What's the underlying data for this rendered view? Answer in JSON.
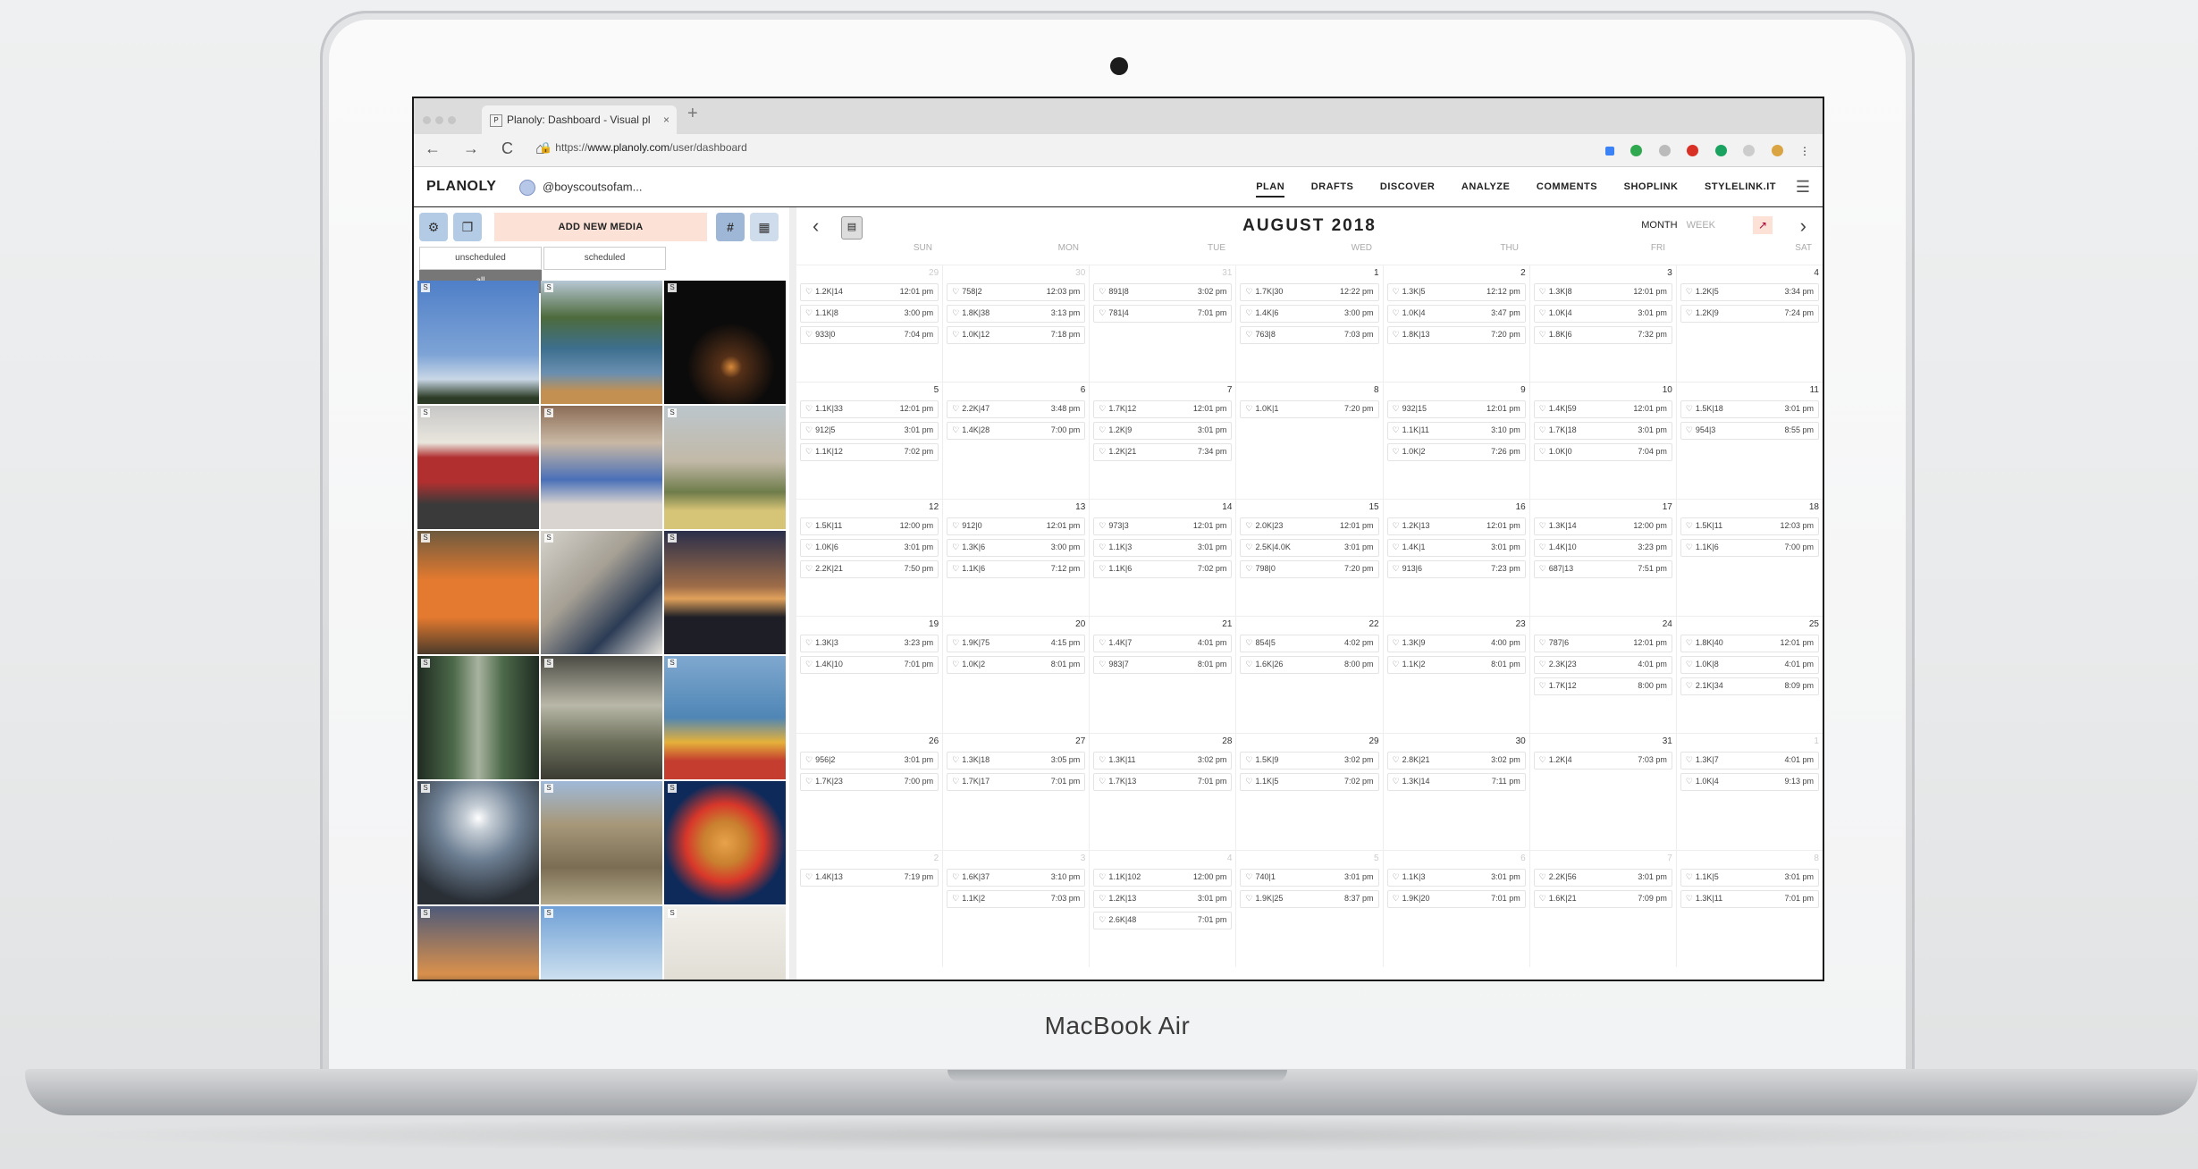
{
  "device": {
    "brand": "MacBook Air"
  },
  "browser": {
    "tab_title": "Planoly: Dashboard - Visual pl",
    "tab_close": "×",
    "new_tab": "+",
    "nav_icons": "← → C ⌂",
    "url_prefix": "https://",
    "url_host": "www.planoly.com",
    "url_path": "/user/dashboard"
  },
  "header": {
    "logo": "PLANOLY",
    "account": "@boyscoutsofam...",
    "menu": [
      "PLAN",
      "DRAFTS",
      "DISCOVER",
      "ANALYZE",
      "COMMENTS",
      "SHOPLINK",
      "STYLELINK.IT"
    ],
    "active": "PLAN"
  },
  "left_panel": {
    "add_media": "ADD NEW MEDIA",
    "hashtag": "#",
    "filters": [
      "unscheduled",
      "scheduled",
      "all"
    ],
    "active_filter": "all",
    "tile_badge": "S",
    "tiles": [
      "sky",
      "canoe-lake",
      "campfire",
      "license-plate",
      "booth",
      "group-outdoor",
      "orange-shirts",
      "computer",
      "sunset-lake",
      "forest-path",
      "sunbeam-forest",
      "kayaks",
      "moon-lake",
      "rocky-tower",
      "pancakes",
      "sunset-city",
      "sky-trees",
      "drawing"
    ]
  },
  "calendar": {
    "title": "AUGUST 2018",
    "view_month": "MONTH",
    "view_week": "WEEK",
    "days": [
      "SUN",
      "MON",
      "TUE",
      "WED",
      "THU",
      "FRI",
      "SAT"
    ],
    "weeks": [
      [
        {
          "d": "29",
          "o": true,
          "p": [
            [
              "1.2K|14",
              "12:01 pm"
            ],
            [
              "1.1K|8",
              "3:00 pm"
            ],
            [
              "933|0",
              "7:04 pm"
            ]
          ]
        },
        {
          "d": "30",
          "o": true,
          "p": [
            [
              "758|2",
              "12:03 pm"
            ],
            [
              "1.8K|38",
              "3:13 pm"
            ],
            [
              "1.0K|12",
              "7:18 pm"
            ]
          ]
        },
        {
          "d": "31",
          "o": true,
          "p": [
            [
              "891|8",
              "3:02 pm"
            ],
            [
              "781|4",
              "7:01 pm"
            ]
          ]
        },
        {
          "d": "1",
          "p": [
            [
              "1.7K|30",
              "12:22 pm"
            ],
            [
              "1.4K|6",
              "3:00 pm"
            ],
            [
              "763|8",
              "7:03 pm"
            ]
          ]
        },
        {
          "d": "2",
          "p": [
            [
              "1.3K|5",
              "12:12 pm"
            ],
            [
              "1.0K|4",
              "3:47 pm"
            ],
            [
              "1.8K|13",
              "7:20 pm"
            ]
          ]
        },
        {
          "d": "3",
          "p": [
            [
              "1.3K|8",
              "12:01 pm"
            ],
            [
              "1.0K|4",
              "3:01 pm"
            ],
            [
              "1.8K|6",
              "7:32 pm"
            ]
          ]
        },
        {
          "d": "4",
          "p": [
            [
              "1.2K|5",
              "3:34 pm"
            ],
            [
              "1.2K|9",
              "7:24 pm"
            ]
          ]
        }
      ],
      [
        {
          "d": "5",
          "p": [
            [
              "1.1K|33",
              "12:01 pm"
            ],
            [
              "912|5",
              "3:01 pm"
            ],
            [
              "1.1K|12",
              "7:02 pm"
            ]
          ]
        },
        {
          "d": "6",
          "p": [
            [
              "2.2K|47",
              "3:48 pm"
            ],
            [
              "1.4K|28",
              "7:00 pm"
            ]
          ]
        },
        {
          "d": "7",
          "p": [
            [
              "1.7K|12",
              "12:01 pm"
            ],
            [
              "1.2K|9",
              "3:01 pm"
            ],
            [
              "1.2K|21",
              "7:34 pm"
            ]
          ]
        },
        {
          "d": "8",
          "p": [
            [
              "1.0K|1",
              "7:20 pm"
            ]
          ]
        },
        {
          "d": "9",
          "p": [
            [
              "932|15",
              "12:01 pm"
            ],
            [
              "1.1K|11",
              "3:10 pm"
            ],
            [
              "1.0K|2",
              "7:26 pm"
            ]
          ]
        },
        {
          "d": "10",
          "p": [
            [
              "1.4K|59",
              "12:01 pm"
            ],
            [
              "1.7K|18",
              "3:01 pm"
            ],
            [
              "1.0K|0",
              "7:04 pm"
            ]
          ]
        },
        {
          "d": "11",
          "p": [
            [
              "1.5K|18",
              "3:01 pm"
            ],
            [
              "954|3",
              "8:55 pm"
            ]
          ]
        }
      ],
      [
        {
          "d": "12",
          "p": [
            [
              "1.5K|11",
              "12:00 pm"
            ],
            [
              "1.0K|6",
              "3:01 pm"
            ],
            [
              "2.2K|21",
              "7:50 pm"
            ]
          ]
        },
        {
          "d": "13",
          "p": [
            [
              "912|0",
              "12:01 pm"
            ],
            [
              "1.3K|6",
              "3:00 pm"
            ],
            [
              "1.1K|6",
              "7:12 pm"
            ]
          ]
        },
        {
          "d": "14",
          "p": [
            [
              "973|3",
              "12:01 pm"
            ],
            [
              "1.1K|3",
              "3:01 pm"
            ],
            [
              "1.1K|6",
              "7:02 pm"
            ]
          ]
        },
        {
          "d": "15",
          "p": [
            [
              "2.0K|23",
              "12:01 pm"
            ],
            [
              "2.5K|4.0K",
              "3:01 pm"
            ],
            [
              "798|0",
              "7:20 pm"
            ]
          ]
        },
        {
          "d": "16",
          "p": [
            [
              "1.2K|13",
              "12:01 pm"
            ],
            [
              "1.4K|1",
              "3:01 pm"
            ],
            [
              "913|6",
              "7:23 pm"
            ]
          ]
        },
        {
          "d": "17",
          "p": [
            [
              "1.3K|14",
              "12:00 pm"
            ],
            [
              "1.4K|10",
              "3:23 pm"
            ],
            [
              "687|13",
              "7:51 pm"
            ]
          ]
        },
        {
          "d": "18",
          "p": [
            [
              "1.5K|11",
              "12:03 pm"
            ],
            [
              "1.1K|6",
              "7:00 pm"
            ]
          ]
        }
      ],
      [
        {
          "d": "19",
          "p": [
            [
              "1.3K|3",
              "3:23 pm"
            ],
            [
              "1.4K|10",
              "7:01 pm"
            ]
          ]
        },
        {
          "d": "20",
          "p": [
            [
              "1.9K|75",
              "4:15 pm"
            ],
            [
              "1.0K|2",
              "8:01 pm"
            ]
          ]
        },
        {
          "d": "21",
          "p": [
            [
              "1.4K|7",
              "4:01 pm"
            ],
            [
              "983|7",
              "8:01 pm"
            ]
          ]
        },
        {
          "d": "22",
          "p": [
            [
              "854|5",
              "4:02 pm"
            ],
            [
              "1.6K|26",
              "8:00 pm"
            ]
          ]
        },
        {
          "d": "23",
          "p": [
            [
              "1.3K|9",
              "4:00 pm"
            ],
            [
              "1.1K|2",
              "8:01 pm"
            ]
          ]
        },
        {
          "d": "24",
          "p": [
            [
              "787|6",
              "12:01 pm"
            ],
            [
              "2.3K|23",
              "4:01 pm"
            ],
            [
              "1.7K|12",
              "8:00 pm"
            ]
          ]
        },
        {
          "d": "25",
          "p": [
            [
              "1.8K|40",
              "12:01 pm"
            ],
            [
              "1.0K|8",
              "4:01 pm"
            ],
            [
              "2.1K|34",
              "8:09 pm"
            ]
          ]
        }
      ],
      [
        {
          "d": "26",
          "p": [
            [
              "956|2",
              "3:01 pm"
            ],
            [
              "1.7K|23",
              "7:00 pm"
            ]
          ]
        },
        {
          "d": "27",
          "p": [
            [
              "1.3K|18",
              "3:05 pm"
            ],
            [
              "1.7K|17",
              "7:01 pm"
            ]
          ]
        },
        {
          "d": "28",
          "p": [
            [
              "1.3K|11",
              "3:02 pm"
            ],
            [
              "1.7K|13",
              "7:01 pm"
            ]
          ]
        },
        {
          "d": "29",
          "p": [
            [
              "1.5K|9",
              "3:02 pm"
            ],
            [
              "1.1K|5",
              "7:02 pm"
            ]
          ]
        },
        {
          "d": "30",
          "p": [
            [
              "2.8K|21",
              "3:02 pm"
            ],
            [
              "1.3K|14",
              "7:11 pm"
            ]
          ]
        },
        {
          "d": "31",
          "p": [
            [
              "1.2K|4",
              "7:03 pm"
            ]
          ]
        },
        {
          "d": "1",
          "o": true,
          "p": [
            [
              "1.3K|7",
              "4:01 pm"
            ],
            [
              "1.0K|4",
              "9:13 pm"
            ]
          ]
        }
      ],
      [
        {
          "d": "2",
          "o": true,
          "p": [
            [
              "1.4K|13",
              "7:19 pm"
            ]
          ]
        },
        {
          "d": "3",
          "o": true,
          "p": [
            [
              "1.6K|37",
              "3:10 pm"
            ],
            [
              "1.1K|2",
              "7:03 pm"
            ]
          ]
        },
        {
          "d": "4",
          "o": true,
          "p": [
            [
              "1.1K|102",
              "12:00 pm"
            ],
            [
              "1.2K|13",
              "3:01 pm"
            ],
            [
              "2.6K|48",
              "7:01 pm"
            ]
          ]
        },
        {
          "d": "5",
          "o": true,
          "p": [
            [
              "740|1",
              "3:01 pm"
            ],
            [
              "1.9K|25",
              "8:37 pm"
            ]
          ]
        },
        {
          "d": "6",
          "o": true,
          "p": [
            [
              "1.1K|3",
              "3:01 pm"
            ],
            [
              "1.9K|20",
              "7:01 pm"
            ]
          ]
        },
        {
          "d": "7",
          "o": true,
          "p": [
            [
              "2.2K|56",
              "3:01 pm"
            ],
            [
              "1.6K|21",
              "7:09 pm"
            ]
          ]
        },
        {
          "d": "8",
          "o": true,
          "p": [
            [
              "1.1K|5",
              "3:01 pm"
            ],
            [
              "1.3K|11",
              "7:01 pm"
            ]
          ]
        }
      ]
    ]
  }
}
